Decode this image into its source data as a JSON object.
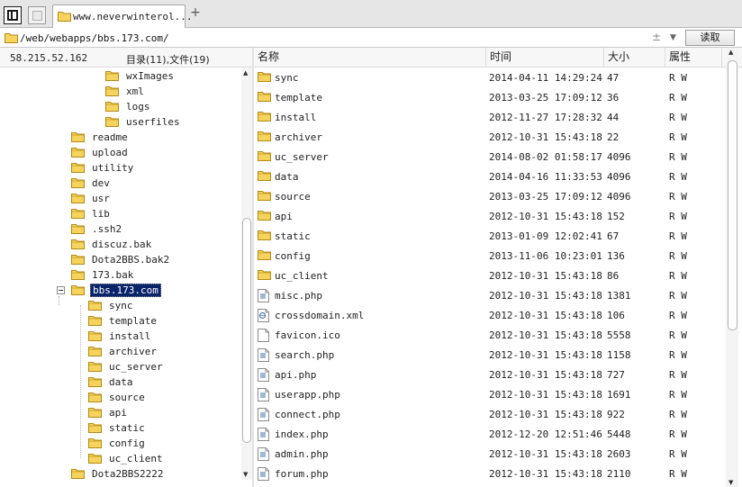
{
  "tabs": {
    "active_label": "www.neverwinterol..."
  },
  "address": {
    "path": "/web/webapps/bbs.173.com/",
    "plus_minus": "±",
    "dropdown_glyph": "▼",
    "read_button": "读取"
  },
  "left_panel": {
    "host": "58.215.52.162",
    "summary": "目录(11),文件(19)"
  },
  "tree": [
    {
      "label": "wxImages",
      "level": 3
    },
    {
      "label": "xml",
      "level": 3
    },
    {
      "label": "logs",
      "level": 3
    },
    {
      "label": "userfiles",
      "level": 3
    },
    {
      "label": "readme",
      "level": 1
    },
    {
      "label": "upload",
      "level": 1
    },
    {
      "label": "utility",
      "level": 1
    },
    {
      "label": "dev",
      "level": 1
    },
    {
      "label": "usr",
      "level": 1
    },
    {
      "label": "lib",
      "level": 1
    },
    {
      "label": ".ssh2",
      "level": 1
    },
    {
      "label": "discuz.bak",
      "level": 1
    },
    {
      "label": "Dota2BBS.bak2",
      "level": 1
    },
    {
      "label": "173.bak",
      "level": 1
    },
    {
      "label": "bbs.173.com",
      "level": 1,
      "selected": true,
      "expanded": true
    },
    {
      "label": "sync",
      "level": 2
    },
    {
      "label": "template",
      "level": 2
    },
    {
      "label": "install",
      "level": 2
    },
    {
      "label": "archiver",
      "level": 2
    },
    {
      "label": "uc_server",
      "level": 2
    },
    {
      "label": "data",
      "level": 2
    },
    {
      "label": "source",
      "level": 2
    },
    {
      "label": "api",
      "level": 2
    },
    {
      "label": "static",
      "level": 2
    },
    {
      "label": "config",
      "level": 2
    },
    {
      "label": "uc_client",
      "level": 2
    },
    {
      "label": "Dota2BBS2222",
      "level": 1
    }
  ],
  "columns": {
    "name": "名称",
    "time": "时间",
    "size": "大小",
    "attr": "属性"
  },
  "files": [
    {
      "name": "sync",
      "time": "2014-04-11 14:29:24",
      "size": "47",
      "attr": "R W",
      "type": "folder"
    },
    {
      "name": "template",
      "time": "2013-03-25 17:09:12",
      "size": "36",
      "attr": "R W",
      "type": "folder"
    },
    {
      "name": "install",
      "time": "2012-11-27 17:28:32",
      "size": "44",
      "attr": "R W",
      "type": "folder"
    },
    {
      "name": "archiver",
      "time": "2012-10-31 15:43:18",
      "size": "22",
      "attr": "R W",
      "type": "folder"
    },
    {
      "name": "uc_server",
      "time": "2014-08-02 01:58:17",
      "size": "4096",
      "attr": "R W",
      "type": "folder"
    },
    {
      "name": "data",
      "time": "2014-04-16 11:33:53",
      "size": "4096",
      "attr": "R W",
      "type": "folder"
    },
    {
      "name": "source",
      "time": "2013-03-25 17:09:12",
      "size": "4096",
      "attr": "R W",
      "type": "folder"
    },
    {
      "name": "api",
      "time": "2012-10-31 15:43:18",
      "size": "152",
      "attr": "R W",
      "type": "folder"
    },
    {
      "name": "static",
      "time": "2013-01-09 12:02:41",
      "size": "67",
      "attr": "R W",
      "type": "folder"
    },
    {
      "name": "config",
      "time": "2013-11-06 10:23:01",
      "size": "136",
      "attr": "R W",
      "type": "folder"
    },
    {
      "name": "uc_client",
      "time": "2012-10-31 15:43:18",
      "size": "86",
      "attr": "R W",
      "type": "folder"
    },
    {
      "name": "misc.php",
      "time": "2012-10-31 15:43:18",
      "size": "1381",
      "attr": "R W",
      "type": "php"
    },
    {
      "name": "crossdomain.xml",
      "time": "2012-10-31 15:43:18",
      "size": "106",
      "attr": "R W",
      "type": "xml"
    },
    {
      "name": "favicon.ico",
      "time": "2012-10-31 15:43:18",
      "size": "5558",
      "attr": "R W",
      "type": "blank"
    },
    {
      "name": "search.php",
      "time": "2012-10-31 15:43:18",
      "size": "1158",
      "attr": "R W",
      "type": "php"
    },
    {
      "name": "api.php",
      "time": "2012-10-31 15:43:18",
      "size": "727",
      "attr": "R W",
      "type": "php"
    },
    {
      "name": "userapp.php",
      "time": "2012-10-31 15:43:18",
      "size": "1691",
      "attr": "R W",
      "type": "php"
    },
    {
      "name": "connect.php",
      "time": "2012-10-31 15:43:18",
      "size": "922",
      "attr": "R W",
      "type": "php"
    },
    {
      "name": "index.php",
      "time": "2012-12-20 12:51:46",
      "size": "5448",
      "attr": "R W",
      "type": "php"
    },
    {
      "name": "admin.php",
      "time": "2012-10-31 15:43:18",
      "size": "2603",
      "attr": "R W",
      "type": "php"
    },
    {
      "name": "forum.php",
      "time": "2012-10-31 15:43:18",
      "size": "2110",
      "attr": "R W",
      "type": "php"
    }
  ],
  "colors": {
    "folder_fill": "#f5d35c",
    "folder_stroke": "#b48a14",
    "selection": "#0a246a"
  }
}
